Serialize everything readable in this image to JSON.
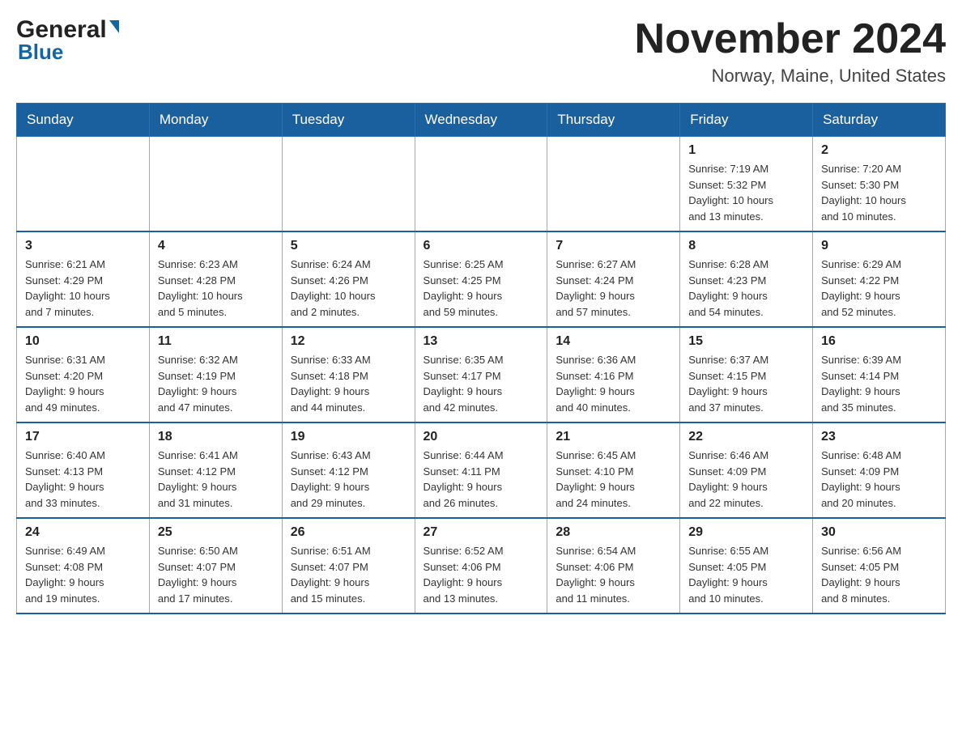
{
  "logo": {
    "general": "General",
    "blue": "Blue"
  },
  "title": "November 2024",
  "subtitle": "Norway, Maine, United States",
  "weekdays": [
    "Sunday",
    "Monday",
    "Tuesday",
    "Wednesday",
    "Thursday",
    "Friday",
    "Saturday"
  ],
  "weeks": [
    [
      {
        "day": "",
        "info": ""
      },
      {
        "day": "",
        "info": ""
      },
      {
        "day": "",
        "info": ""
      },
      {
        "day": "",
        "info": ""
      },
      {
        "day": "",
        "info": ""
      },
      {
        "day": "1",
        "info": "Sunrise: 7:19 AM\nSunset: 5:32 PM\nDaylight: 10 hours\nand 13 minutes."
      },
      {
        "day": "2",
        "info": "Sunrise: 7:20 AM\nSunset: 5:30 PM\nDaylight: 10 hours\nand 10 minutes."
      }
    ],
    [
      {
        "day": "3",
        "info": "Sunrise: 6:21 AM\nSunset: 4:29 PM\nDaylight: 10 hours\nand 7 minutes."
      },
      {
        "day": "4",
        "info": "Sunrise: 6:23 AM\nSunset: 4:28 PM\nDaylight: 10 hours\nand 5 minutes."
      },
      {
        "day": "5",
        "info": "Sunrise: 6:24 AM\nSunset: 4:26 PM\nDaylight: 10 hours\nand 2 minutes."
      },
      {
        "day": "6",
        "info": "Sunrise: 6:25 AM\nSunset: 4:25 PM\nDaylight: 9 hours\nand 59 minutes."
      },
      {
        "day": "7",
        "info": "Sunrise: 6:27 AM\nSunset: 4:24 PM\nDaylight: 9 hours\nand 57 minutes."
      },
      {
        "day": "8",
        "info": "Sunrise: 6:28 AM\nSunset: 4:23 PM\nDaylight: 9 hours\nand 54 minutes."
      },
      {
        "day": "9",
        "info": "Sunrise: 6:29 AM\nSunset: 4:22 PM\nDaylight: 9 hours\nand 52 minutes."
      }
    ],
    [
      {
        "day": "10",
        "info": "Sunrise: 6:31 AM\nSunset: 4:20 PM\nDaylight: 9 hours\nand 49 minutes."
      },
      {
        "day": "11",
        "info": "Sunrise: 6:32 AM\nSunset: 4:19 PM\nDaylight: 9 hours\nand 47 minutes."
      },
      {
        "day": "12",
        "info": "Sunrise: 6:33 AM\nSunset: 4:18 PM\nDaylight: 9 hours\nand 44 minutes."
      },
      {
        "day": "13",
        "info": "Sunrise: 6:35 AM\nSunset: 4:17 PM\nDaylight: 9 hours\nand 42 minutes."
      },
      {
        "day": "14",
        "info": "Sunrise: 6:36 AM\nSunset: 4:16 PM\nDaylight: 9 hours\nand 40 minutes."
      },
      {
        "day": "15",
        "info": "Sunrise: 6:37 AM\nSunset: 4:15 PM\nDaylight: 9 hours\nand 37 minutes."
      },
      {
        "day": "16",
        "info": "Sunrise: 6:39 AM\nSunset: 4:14 PM\nDaylight: 9 hours\nand 35 minutes."
      }
    ],
    [
      {
        "day": "17",
        "info": "Sunrise: 6:40 AM\nSunset: 4:13 PM\nDaylight: 9 hours\nand 33 minutes."
      },
      {
        "day": "18",
        "info": "Sunrise: 6:41 AM\nSunset: 4:12 PM\nDaylight: 9 hours\nand 31 minutes."
      },
      {
        "day": "19",
        "info": "Sunrise: 6:43 AM\nSunset: 4:12 PM\nDaylight: 9 hours\nand 29 minutes."
      },
      {
        "day": "20",
        "info": "Sunrise: 6:44 AM\nSunset: 4:11 PM\nDaylight: 9 hours\nand 26 minutes."
      },
      {
        "day": "21",
        "info": "Sunrise: 6:45 AM\nSunset: 4:10 PM\nDaylight: 9 hours\nand 24 minutes."
      },
      {
        "day": "22",
        "info": "Sunrise: 6:46 AM\nSunset: 4:09 PM\nDaylight: 9 hours\nand 22 minutes."
      },
      {
        "day": "23",
        "info": "Sunrise: 6:48 AM\nSunset: 4:09 PM\nDaylight: 9 hours\nand 20 minutes."
      }
    ],
    [
      {
        "day": "24",
        "info": "Sunrise: 6:49 AM\nSunset: 4:08 PM\nDaylight: 9 hours\nand 19 minutes."
      },
      {
        "day": "25",
        "info": "Sunrise: 6:50 AM\nSunset: 4:07 PM\nDaylight: 9 hours\nand 17 minutes."
      },
      {
        "day": "26",
        "info": "Sunrise: 6:51 AM\nSunset: 4:07 PM\nDaylight: 9 hours\nand 15 minutes."
      },
      {
        "day": "27",
        "info": "Sunrise: 6:52 AM\nSunset: 4:06 PM\nDaylight: 9 hours\nand 13 minutes."
      },
      {
        "day": "28",
        "info": "Sunrise: 6:54 AM\nSunset: 4:06 PM\nDaylight: 9 hours\nand 11 minutes."
      },
      {
        "day": "29",
        "info": "Sunrise: 6:55 AM\nSunset: 4:05 PM\nDaylight: 9 hours\nand 10 minutes."
      },
      {
        "day": "30",
        "info": "Sunrise: 6:56 AM\nSunset: 4:05 PM\nDaylight: 9 hours\nand 8 minutes."
      }
    ]
  ]
}
